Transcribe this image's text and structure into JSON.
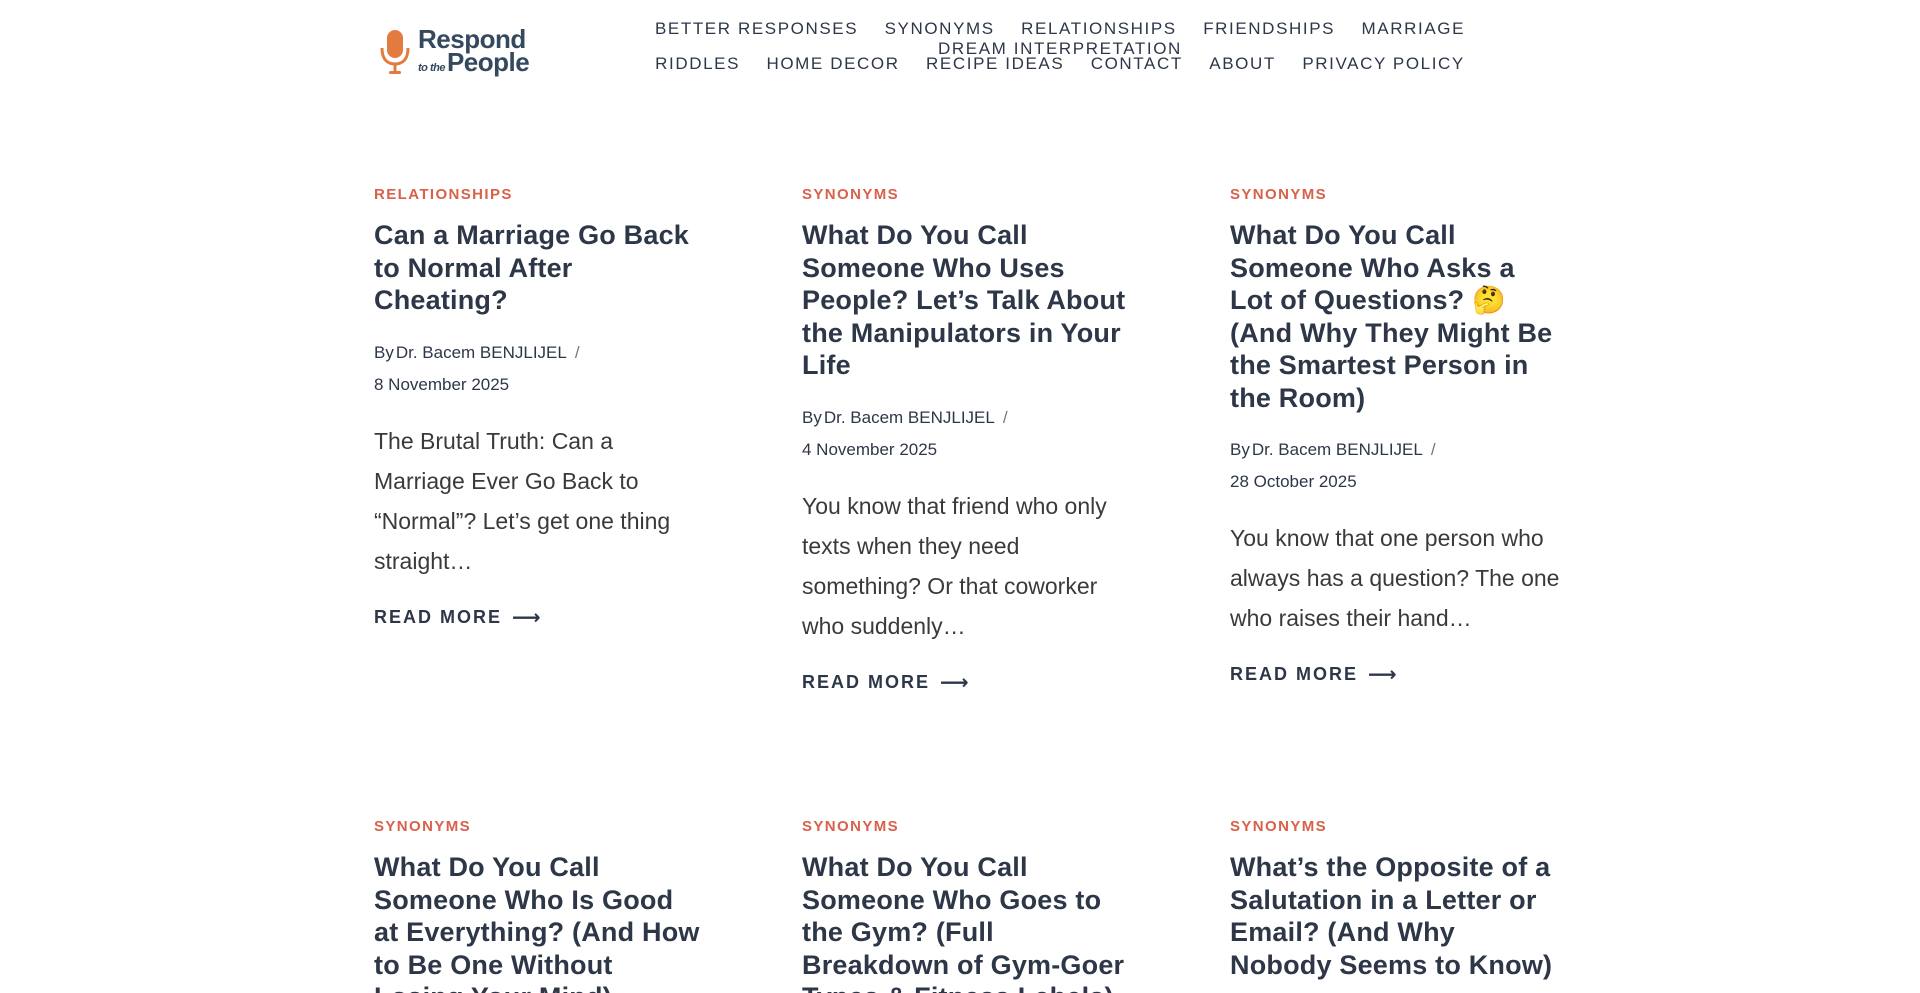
{
  "header": {
    "logo": {
      "line1": "Respond",
      "small": "to the",
      "line2": "People",
      "brand_color": "#e37a3f"
    },
    "nav_row1": [
      "Better Responses",
      "Synonyms",
      "Relationships",
      "Friendships",
      "Marriage",
      "Dream Interpretation"
    ],
    "nav_row2": [
      "Riddles",
      "Home Decor",
      "Recipe Ideas",
      "Contact",
      "About",
      "Privacy Policy"
    ]
  },
  "colors": {
    "category": "#d9604a",
    "text": "#2d3748"
  },
  "posts": [
    {
      "category": "Relationships",
      "title": "Can a Marriage Go Back to Normal After Cheating?",
      "by": "By",
      "author": "Dr. Bacem BENJLIJEL",
      "separator": "/",
      "date": "8 November 2025",
      "excerpt": "The Brutal Truth: Can a Marriage Ever Go Back to “Normal”? Let’s get one thing straight…",
      "read_more": "Read More",
      "arrow": "⟶"
    },
    {
      "category": "Synonyms",
      "title": "What Do You Call Someone Who Uses People? Let’s Talk About the Manipulators in Your Life",
      "by": "By",
      "author": "Dr. Bacem BENJLIJEL",
      "separator": "/",
      "date": "4 November 2025",
      "excerpt": "You know that friend who only texts when they need something? Or that coworker who suddenly…",
      "read_more": "Read More",
      "arrow": "⟶"
    },
    {
      "category": "Synonyms",
      "title": "What Do You Call Someone Who Asks a Lot of Questions? 🤔 (And Why They Might Be the Smartest Person in the Room)",
      "by": "By",
      "author": "Dr. Bacem BENJLIJEL",
      "separator": "/",
      "date": "28 October 2025",
      "excerpt": "You know that one person who always has a question? The one who raises their hand…",
      "read_more": "Read More",
      "arrow": "⟶"
    },
    {
      "category": "Synonyms",
      "title": "What Do You Call Someone Who Is Good at Everything? (And How to Be One Without Losing Your Mind)"
    },
    {
      "category": "Synonyms",
      "title": "What Do You Call Someone Who Goes to the Gym? (Full Breakdown of Gym-Goer Types & Fitness Labels)"
    },
    {
      "category": "Synonyms",
      "title": "What’s the Opposite of a Salutation in a Letter or Email? (And Why Nobody Seems to Know)"
    }
  ]
}
